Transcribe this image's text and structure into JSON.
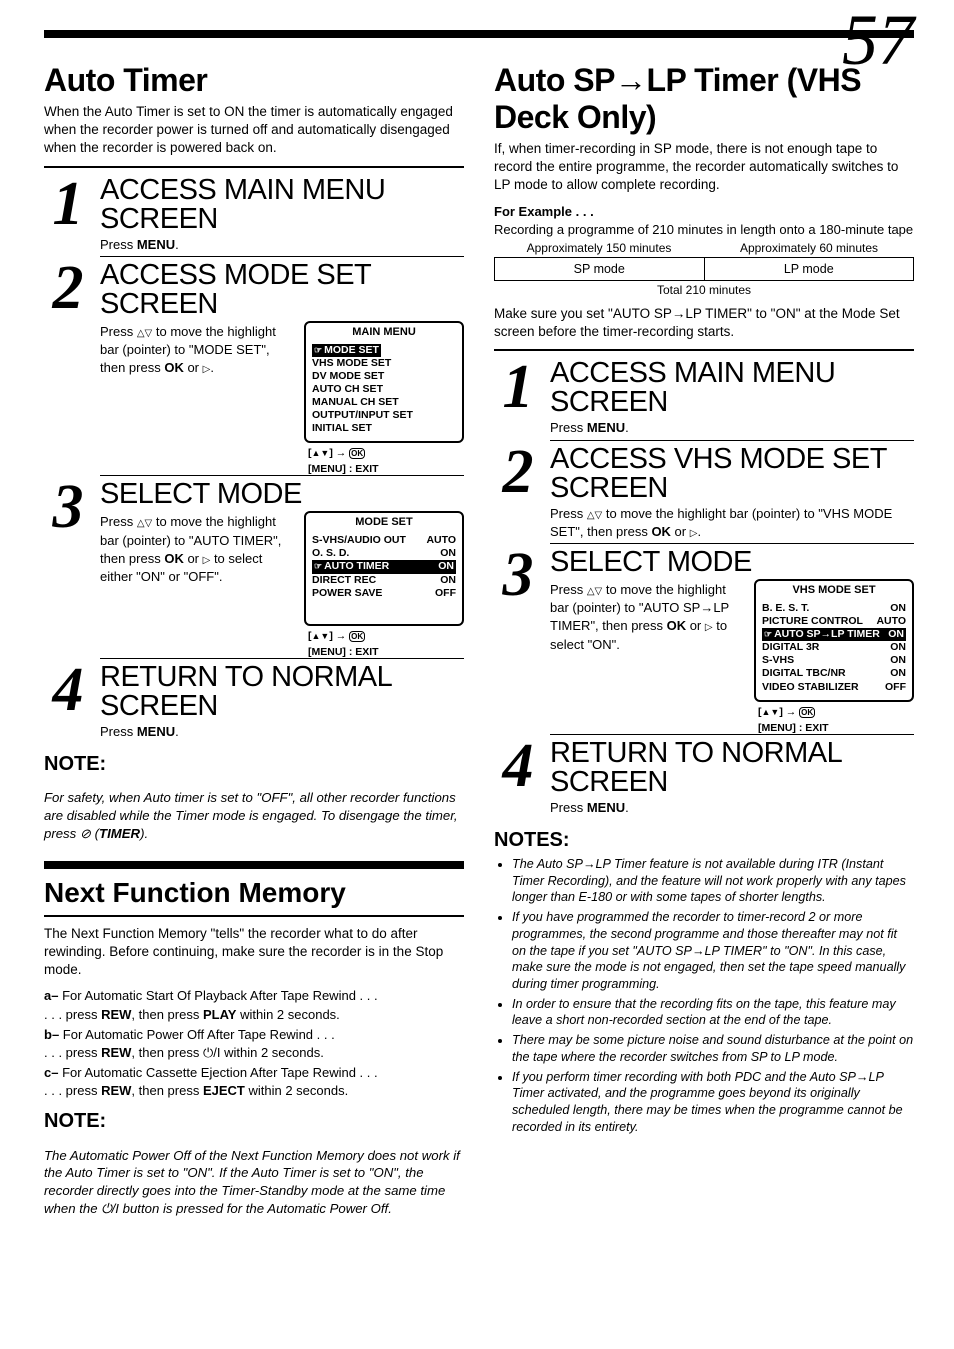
{
  "pageNumber": "57",
  "left": {
    "autoTimer": {
      "title": "Auto Timer",
      "intro": "When the Auto Timer is set to ON the timer is automatically engaged when the recorder power is turned off and automatically disengaged when the recorder is powered back on.",
      "steps": [
        {
          "num": "1",
          "title": "ACCESS MAIN MENU SCREEN",
          "textPrefix": "Press ",
          "textBold": "MENU",
          "textSuffix": "."
        },
        {
          "num": "2",
          "title": "ACCESS MODE SET SCREEN",
          "text": "Press △▽ to move the highlight bar (pointer) to \"MODE SET\", then press OK or ▷.",
          "osd": {
            "title": "MAIN MENU",
            "lines": [
              "MODE SET",
              "VHS MODE SET",
              "DV MODE SET",
              "AUTO CH SET",
              "MANUAL CH SET",
              "OUTPUT/INPUT SET",
              "INITIAL SET"
            ],
            "highlightIndex": 0,
            "foot1": "[▲▼] → OK",
            "foot2": "[MENU] : EXIT"
          }
        },
        {
          "num": "3",
          "title": "SELECT MODE",
          "text": "Press △▽ to move the highlight bar (pointer) to \"AUTO TIMER\", then press OK or ▷ to select either \"ON\" or \"OFF\".",
          "osd": {
            "title": "MODE SET",
            "rows": [
              {
                "label": "S-VHS/AUDIO OUT",
                "value": "AUTO"
              },
              {
                "label": "O. S. D.",
                "value": "ON"
              },
              {
                "label": "AUTO TIMER",
                "value": "ON",
                "hl": true
              },
              {
                "label": "DIRECT REC",
                "value": "ON"
              },
              {
                "label": "POWER SAVE",
                "value": "OFF"
              }
            ],
            "foot1": "[▲▼] → OK",
            "foot2": "[MENU] : EXIT"
          }
        },
        {
          "num": "4",
          "title": "RETURN TO NORMAL SCREEN",
          "textPrefix": "Press ",
          "textBold": "MENU",
          "textSuffix": "."
        }
      ],
      "noteTitle": "NOTE:",
      "noteText": "For safety, when Auto timer is set to \"OFF\", all other recorder functions are disabled while the Timer mode is engaged. To disengage the timer, press ⊘ (TIMER)."
    },
    "nfm": {
      "title": "Next Function Memory",
      "intro": "The Next Function Memory \"tells\" the recorder what to do after rewinding. Before continuing, make sure the recorder is in the Stop mode.",
      "items": [
        {
          "letter": "a–",
          "head": " For Automatic Start Of Playback After Tape Rewind . . .",
          "line2": ". . . press REW, then press PLAY within 2 seconds."
        },
        {
          "letter": "b–",
          "head": " For Automatic Power Off After Tape Rewind . . .",
          "line2": ". . . press REW, then press ⏻/І within 2 seconds."
        },
        {
          "letter": "c–",
          "head": " For Automatic Cassette Ejection After Tape Rewind . . .",
          "line2": ". . . press REW, then press EJECT within 2 seconds."
        }
      ],
      "noteTitle": "NOTE:",
      "noteText": "The Automatic Power Off of the Next Function Memory does not work if the Auto Timer is set to \"ON\". If the Auto Timer is set to \"ON\", the recorder directly goes into the Timer-Standby mode at the same time when the ⏻/І button is pressed for the Automatic Power Off."
    }
  },
  "right": {
    "splp": {
      "title": "Auto SP→LP Timer (VHS Deck Only)",
      "intro": "If, when timer-recording in SP mode, there is not enough tape to record the entire programme, the recorder automatically switches to LP mode to allow complete recording.",
      "forExampleLabel": "For Example . . .",
      "forExampleText": "Recording a programme of 210 minutes in length onto a 180-minute tape",
      "approx": [
        "Approximately 150 minutes",
        "Approximately 60 minutes"
      ],
      "modes": [
        "SP mode",
        "LP mode"
      ],
      "total": "Total 210 minutes",
      "after": "Make sure you set \"AUTO SP→LP TIMER\" to \"ON\" at the Mode Set screen before the timer-recording starts.",
      "steps": [
        {
          "num": "1",
          "title": "ACCESS MAIN MENU SCREEN",
          "textPrefix": "Press ",
          "textBold": "MENU",
          "textSuffix": "."
        },
        {
          "num": "2",
          "title": "ACCESS VHS MODE SET SCREEN",
          "text": "Press △▽ to move the highlight bar (pointer) to \"VHS MODE SET\", then press OK or ▷."
        },
        {
          "num": "3",
          "title": "SELECT MODE",
          "text": "Press △▽ to move the highlight bar (pointer) to \"AUTO SP→LP TIMER\", then press OK or ▷ to select \"ON\".",
          "osd": {
            "title": "VHS MODE SET",
            "rows": [
              {
                "label": "B. E. S. T.",
                "value": "ON"
              },
              {
                "label": "PICTURE CONTROL",
                "value": "AUTO"
              },
              {
                "label": "AUTO SP→LP TIMER",
                "value": "ON",
                "hl": true
              },
              {
                "label": "DIGITAL 3R",
                "value": "ON"
              },
              {
                "label": "S-VHS",
                "value": "ON"
              },
              {
                "label": "DIGITAL TBC/NR",
                "value": "ON"
              },
              {
                "label": "VIDEO STABILIZER",
                "value": "OFF"
              }
            ],
            "foot1": "[▲▼] → OK",
            "foot2": "[MENU] : EXIT"
          }
        },
        {
          "num": "4",
          "title": "RETURN TO NORMAL SCREEN",
          "textPrefix": "Press ",
          "textBold": "MENU",
          "textSuffix": "."
        }
      ],
      "notesTitle": "NOTES:",
      "notes": [
        "The Auto SP→LP Timer feature is not available during ITR (Instant Timer Recording), and the feature will not work properly with any tapes longer than E-180 or with some tapes of shorter lengths.",
        "If you have programmed the recorder to timer-record 2 or more programmes, the second programme and those thereafter may not fit on the tape if you set \"AUTO SP→LP TIMER\" to \"ON\". In this case, make sure the mode is not engaged, then set the tape speed manually during timer programming.",
        "In order to ensure that the recording fits on the tape, this feature may leave a short non-recorded section at the end of the tape.",
        "There may be some picture noise and sound disturbance at the point on the tape where the recorder switches from SP to LP mode.",
        "If you perform timer recording with both PDC and the Auto SP→LP Timer activated, and the programme goes beyond its originally scheduled length, there may be times when the programme cannot be recorded in its entirety."
      ]
    }
  }
}
